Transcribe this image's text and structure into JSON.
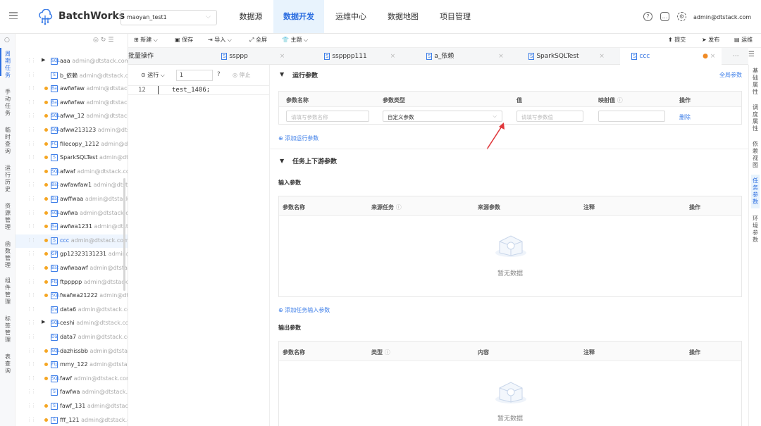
{
  "app": {
    "brand": "BatchWorks",
    "project": "maoyan_test1",
    "user": "admin@dtstack.com"
  },
  "nav": [
    "数据源",
    "数据开发",
    "运维中心",
    "数据地图",
    "项目管理"
  ],
  "left_rail": [
    "周期任务",
    "手动任务",
    "临时查询",
    "运行历史",
    "资源管理",
    "函数管理",
    "组件管理",
    "标签管理",
    "表查询"
  ],
  "tree": [
    {
      "name": "aaa",
      "owner": "admin@dtstack.com",
      "type": "SQL",
      "expand": true
    },
    {
      "name": "b_依赖",
      "owner": "admin@dtstack.com",
      "type": "S"
    },
    {
      "name": "awfwfaw",
      "owner": "admin@dtstack.com",
      "type": "Bat",
      "dot": true
    },
    {
      "name": "awfwfaw",
      "owner": "admin@dtstack.com",
      "type": "Bat",
      "dot": true
    },
    {
      "name": "afww_12",
      "owner": "admin@dtstack.com",
      "type": "SQL",
      "dot": true
    },
    {
      "name": "afww213123",
      "owner": "admin@dtstack.com",
      "type": "SQL",
      "dot": true
    },
    {
      "name": "filecopy_1212",
      "owner": "admin@dtstack.com",
      "type": "FC",
      "dot": true
    },
    {
      "name": "SparkSQLTest",
      "owner": "admin@dtstack.com",
      "type": "S",
      "dot": true
    },
    {
      "name": "afwaf",
      "owner": "admin@dtstack.com",
      "type": "SQL",
      "dot": true
    },
    {
      "name": "awfawfaw1",
      "owner": "admin@dtstack.com",
      "type": "Bat",
      "dot": true
    },
    {
      "name": "awffwaa",
      "owner": "admin@dtstack.com",
      "type": "Bat",
      "dot": true
    },
    {
      "name": "awfwa",
      "owner": "admin@dtstack.com",
      "type": "SQL",
      "dot": true
    },
    {
      "name": "awfwa1231",
      "owner": "admin@dtstack.com",
      "type": "Bat",
      "dot": true
    },
    {
      "name": "ccc",
      "owner": "admin@dtstack.com",
      "type": "S",
      "dot": true,
      "active": true
    },
    {
      "name": "gp12323131231",
      "owner": "admin@dtstack.com",
      "type": "GP",
      "dot": true
    },
    {
      "name": "awfwaawf",
      "owner": "admin@dtstack.com",
      "type": "Bat",
      "dot": true
    },
    {
      "name": "ftppppp",
      "owner": "admin@dtstack.com",
      "type": "Ftp",
      "dot": true
    },
    {
      "name": "fwafwa21222",
      "owner": "admin@dtstack.com",
      "type": "SQL",
      "dot": true
    },
    {
      "name": "data6",
      "owner": "admin@dtstack.com",
      "type": "Da"
    },
    {
      "name": "ceshi",
      "owner": "admin@dtstack.com",
      "type": "SQL",
      "expand": true
    },
    {
      "name": "data7",
      "owner": "admin@dtstack.com",
      "type": "Da"
    },
    {
      "name": "dazhissbb",
      "owner": "admin@dtstack.com",
      "type": "SQL",
      "dot": true
    },
    {
      "name": "mmy_122",
      "owner": "admin@dtstack.com",
      "type": "Ftp",
      "dot": true
    },
    {
      "name": "fawf",
      "owner": "admin@dtstack.com",
      "type": "SQL",
      "dot": true
    },
    {
      "name": "fawfwa",
      "owner": "admin@dtstack.com",
      "type": "S"
    },
    {
      "name": "fawf_131",
      "owner": "admin@dtstack.com",
      "type": "S",
      "dot": true
    },
    {
      "name": "fff_121",
      "owner": "admin@dtstack.com",
      "type": "S",
      "dot": true
    }
  ],
  "toolbar": {
    "new": "新建",
    "save": "保存",
    "import": "导入",
    "all": "全屏",
    "theme": "主题",
    "submit": "提交",
    "publish": "发布",
    "ops": "运维"
  },
  "tabs": [
    "批量操作",
    "ssppp",
    "sspppp111",
    "a_依赖",
    "SparkSQLTest",
    "ccc"
  ],
  "code": {
    "run": "运行",
    "limit": "1",
    "stop": "停止",
    "line_no": "12",
    "line": "test_1406;"
  },
  "run_params": {
    "title": "运行参数",
    "global": "全局参数",
    "cols": [
      "参数名称",
      "参数类型",
      "值",
      "映射值",
      "操作"
    ],
    "name_ph": "请填写参数名称",
    "type_val": "自定义参数",
    "value_ph": "请填写参数值",
    "del": "删除",
    "add": "添加运行参数"
  },
  "updown": {
    "title": "任务上下游参数",
    "input_title": "输入参数",
    "input_cols": [
      "参数名称",
      "来源任务",
      "来源参数",
      "注释",
      "操作"
    ],
    "empty": "暂无数据",
    "add_input": "添加任务输入参数",
    "output_title": "输出参数",
    "output_cols": [
      "参数名称",
      "类型",
      "内容",
      "注释",
      "操作"
    ]
  },
  "right_rail": [
    "基础属性",
    "调度属性",
    "依赖视图",
    "任务参数",
    "环境参数"
  ],
  "colors": {
    "accent": "#2b6de0",
    "dot": "#f5a623",
    "arrow": "#e0383c"
  }
}
